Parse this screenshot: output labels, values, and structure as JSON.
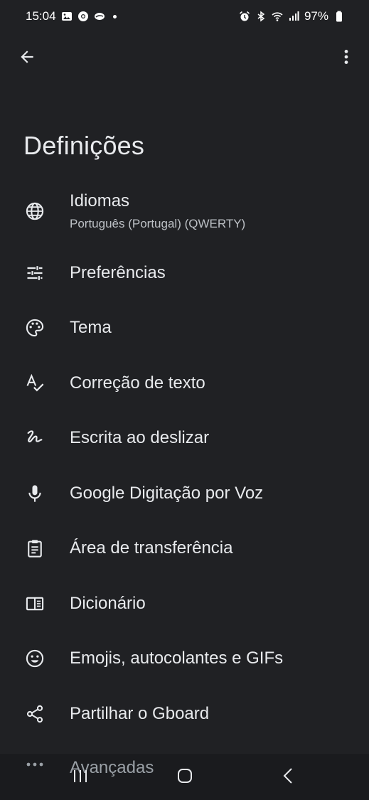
{
  "status_bar": {
    "time": "15:04",
    "battery": "97%"
  },
  "app_bar": {
    "back_icon": "arrow-back-icon",
    "more_icon": "more-vert-icon"
  },
  "page": {
    "title": "Definições"
  },
  "settings": {
    "items": [
      {
        "icon": "globe-icon",
        "label": "Idiomas",
        "sublabel": "Português (Portugal) (QWERTY)"
      },
      {
        "icon": "tune-icon",
        "label": "Preferências"
      },
      {
        "icon": "palette-icon",
        "label": "Tema"
      },
      {
        "icon": "spellcheck-icon",
        "label": "Correção de texto"
      },
      {
        "icon": "gesture-icon",
        "label": "Escrita ao deslizar"
      },
      {
        "icon": "mic-icon",
        "label": "Google Digitação por Voz"
      },
      {
        "icon": "clipboard-icon",
        "label": "Área de transferência"
      },
      {
        "icon": "book-icon",
        "label": "Dicionário"
      },
      {
        "icon": "emoji-icon",
        "label": "Emojis, autocolantes e GIFs"
      },
      {
        "icon": "share-icon",
        "label": "Partilhar o Gboard"
      }
    ],
    "peek_item": {
      "icon": "more-horiz-icon",
      "label": "Avançadas"
    }
  },
  "colors": {
    "background": "#202124",
    "text_primary": "#e8eaed",
    "text_secondary": "#bdc1c6",
    "nav_background": "#1a1b1e"
  }
}
